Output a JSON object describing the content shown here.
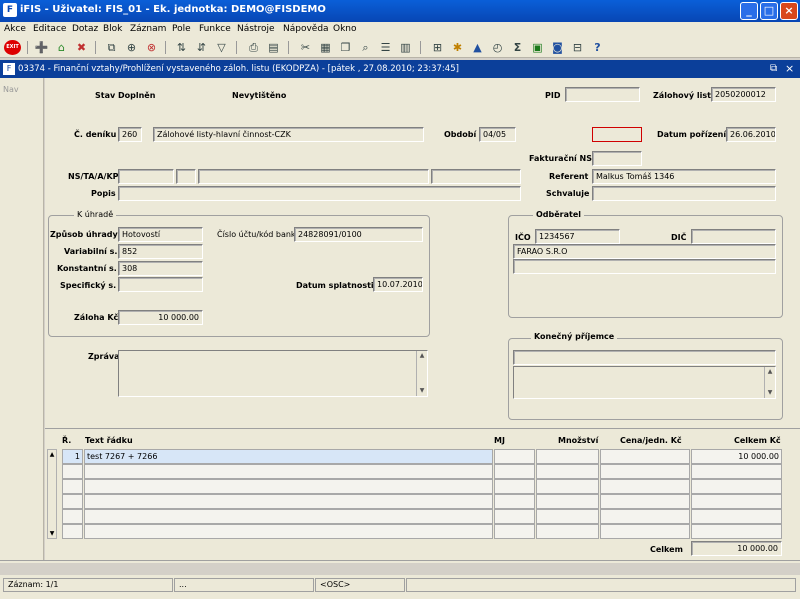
{
  "window": {
    "title": "iFIS - Uživatel: FIS_01 - Ek. jednotka: DEMO@FISDEMO",
    "app_icon": "F"
  },
  "menu": [
    "Akce",
    "Editace",
    "Dotaz",
    "Blok",
    "Záznam",
    "Pole",
    "Funkce",
    "Nástroje",
    "Nápověda",
    "Okno"
  ],
  "toolbar": {
    "exit_label": "EXIT"
  },
  "inner_window": {
    "title": "03374 - Finanční vztahy/Prohlížení vystaveného záloh. listu (EKODPZA) - [pátek  , 27.08.2010; 23:37:45]",
    "left_panel_label": "Nav"
  },
  "header": {
    "stav_label": "Stav",
    "stav_value": "Doplněn",
    "tisk_value": "Nevytištěno",
    "pid_label": "PID",
    "pid_value": "",
    "zalohovy_list_label": "Zálohový list",
    "zalohovy_list_value": "2050200012",
    "c_deniku_label": "Č. deníku",
    "c_deniku_value": "260",
    "denik_name": "Zálohové listy-hlavní činnost-CZK",
    "obdobi_label": "Období",
    "obdobi_value": "04/05",
    "datum_porizeni_label": "Datum pořízení",
    "datum_porizeni_value": "26.06.2010",
    "fakturacni_ns_label": "Fakturační NS",
    "ns_label": "NS/TA/A/KP",
    "popis_label": "Popis",
    "referent_label": "Referent",
    "referent_value": "Malkus Tomáš 1346",
    "schvaluje_label": "Schvaluje"
  },
  "k_uhrade": {
    "title": "K úhradě",
    "zpusob_label": "Způsob úhrady",
    "zpusob_value": "Hotovostí",
    "ucet_label": "Číslo účtu/kód banky",
    "ucet_value": "24828091/0100",
    "vs_label": "Variabilní s.",
    "vs_value": "852",
    "ks_label": "Konstantní s.",
    "ks_value": "308",
    "ss_label": "Specifický s.",
    "ss_value": "",
    "splatnost_label": "Datum splatnosti",
    "splatnost_value": "10.07.2010",
    "zaloha_label": "Záloha Kč",
    "zaloha_value": "10 000.00"
  },
  "odberatel": {
    "title": "Odběratel",
    "ico_label": "IČO",
    "ico_value": "1234567",
    "dic_label": "DIČ",
    "dic_value": "",
    "name": "FARAO S.R.O"
  },
  "zprava_label": "Zpráva",
  "konecny_prijemce_title": "Konečný příjemce",
  "grid": {
    "headers": {
      "r": "Ř.",
      "text": "Text řádku",
      "mj": "MJ",
      "mnozstvi": "Množství",
      "cena": "Cena/jedn. Kč",
      "celkem": "Celkem Kč"
    },
    "rows": [
      {
        "r": "1",
        "text": "test 7267 + 7266",
        "mj": "",
        "mnozstvi": "",
        "cena": "",
        "celkem": "10 000.00"
      }
    ],
    "total_label": "Celkem",
    "total_value": "10 000.00"
  },
  "status": {
    "zaznam": "Záznam: 1/1",
    "dots": "...",
    "osc": "<OSC>"
  },
  "colors": {
    "title_bar": "#0846b4",
    "inner_bar": "#0b3f9a",
    "required_border": "#d00000",
    "selected_row": "#d7e6f7"
  }
}
